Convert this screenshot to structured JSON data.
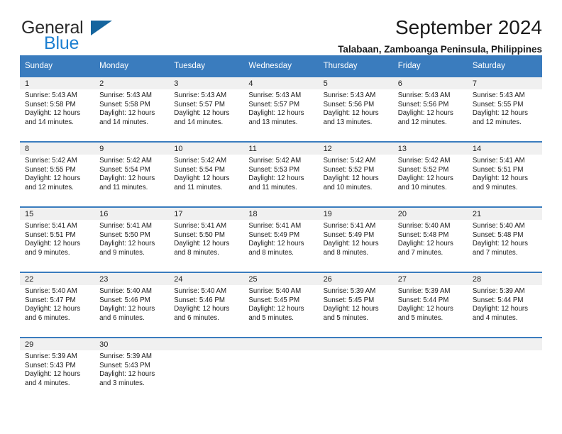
{
  "brand": {
    "name_part1": "General",
    "name_part2": "Blue",
    "triangle_color": "#15659e",
    "blue_color": "#1c7fd1"
  },
  "header": {
    "title": "September 2024",
    "subtitle": "Talabaan, Zamboanga Peninsula, Philippines"
  },
  "theme": {
    "header_bg": "#3a7cbe",
    "daynum_bg": "#f0f0f0",
    "row_border": "#3a7cbe"
  },
  "weekdays": [
    "Sunday",
    "Monday",
    "Tuesday",
    "Wednesday",
    "Thursday",
    "Friday",
    "Saturday"
  ],
  "weeks": [
    [
      {
        "day": "1",
        "sunrise": "Sunrise: 5:43 AM",
        "sunset": "Sunset: 5:58 PM",
        "daylight": "Daylight: 12 hours and 14 minutes."
      },
      {
        "day": "2",
        "sunrise": "Sunrise: 5:43 AM",
        "sunset": "Sunset: 5:58 PM",
        "daylight": "Daylight: 12 hours and 14 minutes."
      },
      {
        "day": "3",
        "sunrise": "Sunrise: 5:43 AM",
        "sunset": "Sunset: 5:57 PM",
        "daylight": "Daylight: 12 hours and 14 minutes."
      },
      {
        "day": "4",
        "sunrise": "Sunrise: 5:43 AM",
        "sunset": "Sunset: 5:57 PM",
        "daylight": "Daylight: 12 hours and 13 minutes."
      },
      {
        "day": "5",
        "sunrise": "Sunrise: 5:43 AM",
        "sunset": "Sunset: 5:56 PM",
        "daylight": "Daylight: 12 hours and 13 minutes."
      },
      {
        "day": "6",
        "sunrise": "Sunrise: 5:43 AM",
        "sunset": "Sunset: 5:56 PM",
        "daylight": "Daylight: 12 hours and 12 minutes."
      },
      {
        "day": "7",
        "sunrise": "Sunrise: 5:43 AM",
        "sunset": "Sunset: 5:55 PM",
        "daylight": "Daylight: 12 hours and 12 minutes."
      }
    ],
    [
      {
        "day": "8",
        "sunrise": "Sunrise: 5:42 AM",
        "sunset": "Sunset: 5:55 PM",
        "daylight": "Daylight: 12 hours and 12 minutes."
      },
      {
        "day": "9",
        "sunrise": "Sunrise: 5:42 AM",
        "sunset": "Sunset: 5:54 PM",
        "daylight": "Daylight: 12 hours and 11 minutes."
      },
      {
        "day": "10",
        "sunrise": "Sunrise: 5:42 AM",
        "sunset": "Sunset: 5:54 PM",
        "daylight": "Daylight: 12 hours and 11 minutes."
      },
      {
        "day": "11",
        "sunrise": "Sunrise: 5:42 AM",
        "sunset": "Sunset: 5:53 PM",
        "daylight": "Daylight: 12 hours and 11 minutes."
      },
      {
        "day": "12",
        "sunrise": "Sunrise: 5:42 AM",
        "sunset": "Sunset: 5:52 PM",
        "daylight": "Daylight: 12 hours and 10 minutes."
      },
      {
        "day": "13",
        "sunrise": "Sunrise: 5:42 AM",
        "sunset": "Sunset: 5:52 PM",
        "daylight": "Daylight: 12 hours and 10 minutes."
      },
      {
        "day": "14",
        "sunrise": "Sunrise: 5:41 AM",
        "sunset": "Sunset: 5:51 PM",
        "daylight": "Daylight: 12 hours and 9 minutes."
      }
    ],
    [
      {
        "day": "15",
        "sunrise": "Sunrise: 5:41 AM",
        "sunset": "Sunset: 5:51 PM",
        "daylight": "Daylight: 12 hours and 9 minutes."
      },
      {
        "day": "16",
        "sunrise": "Sunrise: 5:41 AM",
        "sunset": "Sunset: 5:50 PM",
        "daylight": "Daylight: 12 hours and 9 minutes."
      },
      {
        "day": "17",
        "sunrise": "Sunrise: 5:41 AM",
        "sunset": "Sunset: 5:50 PM",
        "daylight": "Daylight: 12 hours and 8 minutes."
      },
      {
        "day": "18",
        "sunrise": "Sunrise: 5:41 AM",
        "sunset": "Sunset: 5:49 PM",
        "daylight": "Daylight: 12 hours and 8 minutes."
      },
      {
        "day": "19",
        "sunrise": "Sunrise: 5:41 AM",
        "sunset": "Sunset: 5:49 PM",
        "daylight": "Daylight: 12 hours and 8 minutes."
      },
      {
        "day": "20",
        "sunrise": "Sunrise: 5:40 AM",
        "sunset": "Sunset: 5:48 PM",
        "daylight": "Daylight: 12 hours and 7 minutes."
      },
      {
        "day": "21",
        "sunrise": "Sunrise: 5:40 AM",
        "sunset": "Sunset: 5:48 PM",
        "daylight": "Daylight: 12 hours and 7 minutes."
      }
    ],
    [
      {
        "day": "22",
        "sunrise": "Sunrise: 5:40 AM",
        "sunset": "Sunset: 5:47 PM",
        "daylight": "Daylight: 12 hours and 6 minutes."
      },
      {
        "day": "23",
        "sunrise": "Sunrise: 5:40 AM",
        "sunset": "Sunset: 5:46 PM",
        "daylight": "Daylight: 12 hours and 6 minutes."
      },
      {
        "day": "24",
        "sunrise": "Sunrise: 5:40 AM",
        "sunset": "Sunset: 5:46 PM",
        "daylight": "Daylight: 12 hours and 6 minutes."
      },
      {
        "day": "25",
        "sunrise": "Sunrise: 5:40 AM",
        "sunset": "Sunset: 5:45 PM",
        "daylight": "Daylight: 12 hours and 5 minutes."
      },
      {
        "day": "26",
        "sunrise": "Sunrise: 5:39 AM",
        "sunset": "Sunset: 5:45 PM",
        "daylight": "Daylight: 12 hours and 5 minutes."
      },
      {
        "day": "27",
        "sunrise": "Sunrise: 5:39 AM",
        "sunset": "Sunset: 5:44 PM",
        "daylight": "Daylight: 12 hours and 5 minutes."
      },
      {
        "day": "28",
        "sunrise": "Sunrise: 5:39 AM",
        "sunset": "Sunset: 5:44 PM",
        "daylight": "Daylight: 12 hours and 4 minutes."
      }
    ],
    [
      {
        "day": "29",
        "sunrise": "Sunrise: 5:39 AM",
        "sunset": "Sunset: 5:43 PM",
        "daylight": "Daylight: 12 hours and 4 minutes."
      },
      {
        "day": "30",
        "sunrise": "Sunrise: 5:39 AM",
        "sunset": "Sunset: 5:43 PM",
        "daylight": "Daylight: 12 hours and 3 minutes."
      },
      {
        "day": "",
        "sunrise": "",
        "sunset": "",
        "daylight": ""
      },
      {
        "day": "",
        "sunrise": "",
        "sunset": "",
        "daylight": ""
      },
      {
        "day": "",
        "sunrise": "",
        "sunset": "",
        "daylight": ""
      },
      {
        "day": "",
        "sunrise": "",
        "sunset": "",
        "daylight": ""
      },
      {
        "day": "",
        "sunrise": "",
        "sunset": "",
        "daylight": ""
      }
    ]
  ]
}
